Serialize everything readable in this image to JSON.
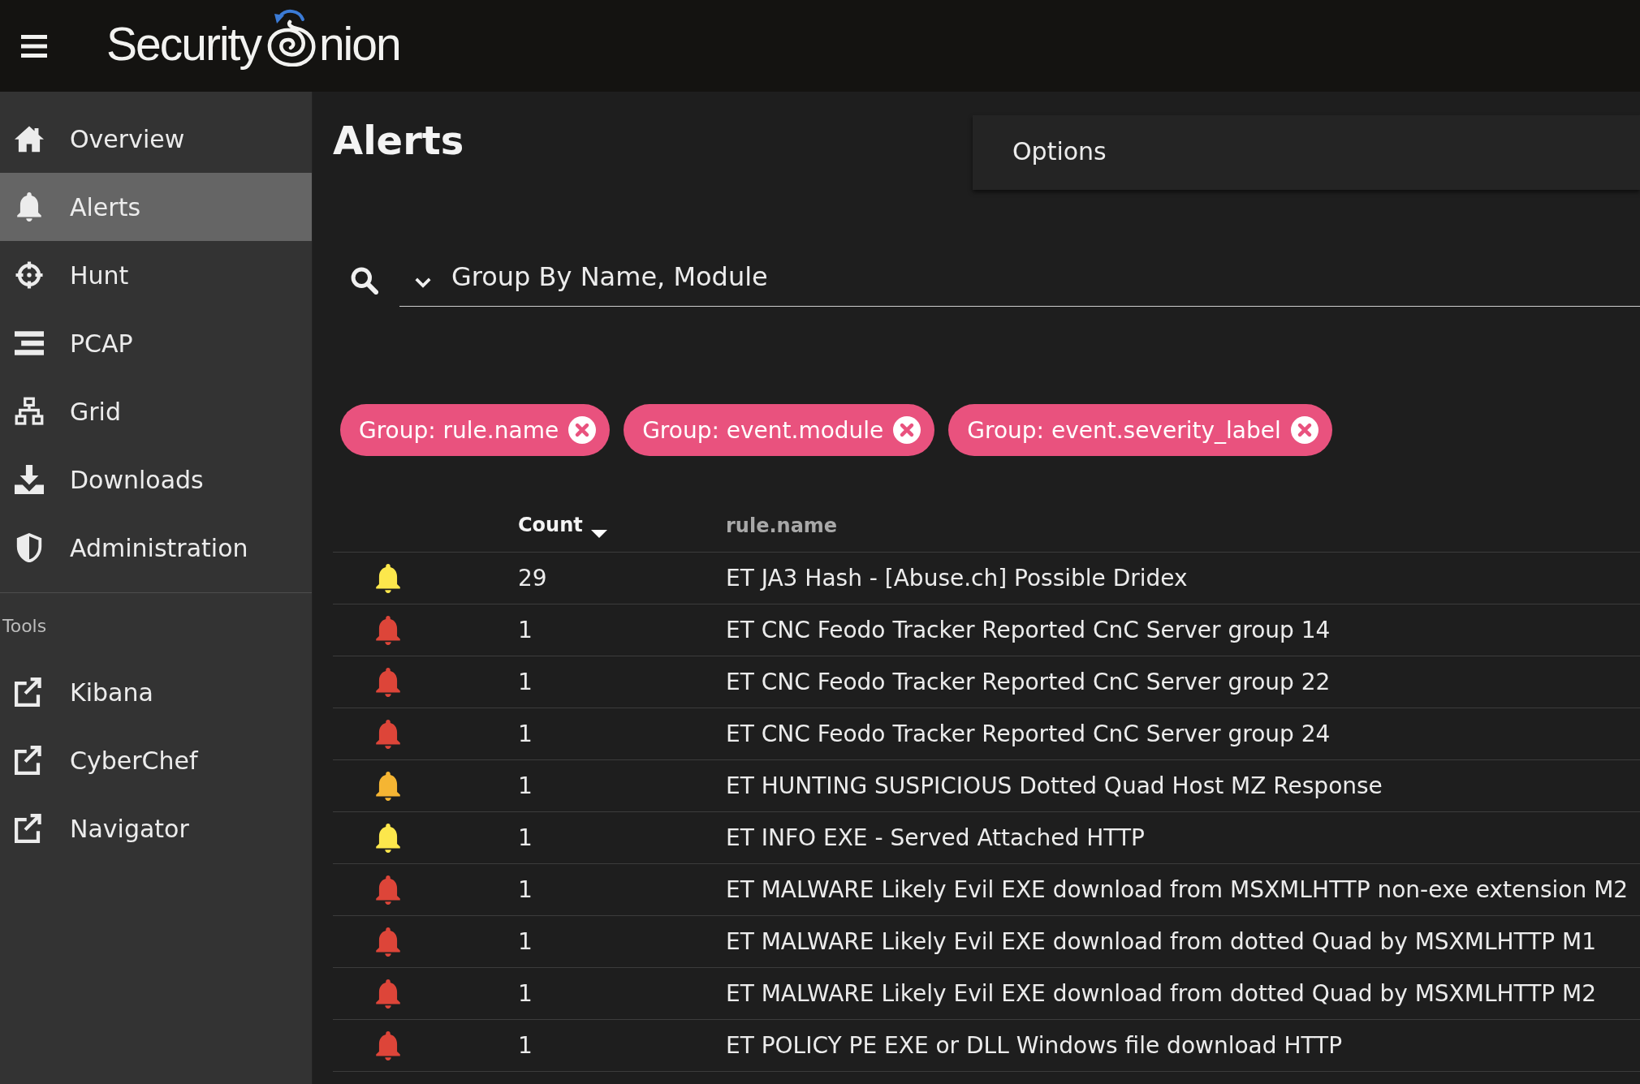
{
  "header": {
    "logo": {
      "before_mark": "Security",
      "after_mark": "nion"
    }
  },
  "sidebar": {
    "items": [
      {
        "label": "Overview",
        "selected": false
      },
      {
        "label": "Alerts",
        "selected": true
      },
      {
        "label": "Hunt",
        "selected": false
      },
      {
        "label": "PCAP",
        "selected": false
      },
      {
        "label": "Grid",
        "selected": false
      },
      {
        "label": "Downloads",
        "selected": false
      },
      {
        "label": "Administration",
        "selected": false
      }
    ],
    "tools_heading": "Tools",
    "tools": [
      {
        "label": "Kibana"
      },
      {
        "label": "CyberChef"
      },
      {
        "label": "Navigator"
      }
    ]
  },
  "page": {
    "title": "Alerts",
    "options_panel": {
      "label": "Options"
    }
  },
  "query": {
    "value": "Group By Name, Module"
  },
  "group_chips": [
    {
      "label": "Group: rule.name"
    },
    {
      "label": "Group: event.module"
    },
    {
      "label": "Group: event.severity_label"
    }
  ],
  "table": {
    "columns": [
      {
        "label": "Count",
        "sorted": true
      },
      {
        "label": "rule.name",
        "sorted": false
      }
    ],
    "rows": [
      {
        "color": "#fce74c",
        "count": "29",
        "rule_name": "ET JA3 Hash - [Abuse.ch] Possible Dridex"
      },
      {
        "color": "#dd4539",
        "count": "1",
        "rule_name": "ET CNC Feodo Tracker Reported CnC Server group 14"
      },
      {
        "color": "#dd4539",
        "count": "1",
        "rule_name": "ET CNC Feodo Tracker Reported CnC Server group 22"
      },
      {
        "color": "#dd4539",
        "count": "1",
        "rule_name": "ET CNC Feodo Tracker Reported CnC Server group 24"
      },
      {
        "color": "#f5b533",
        "count": "1",
        "rule_name": "ET HUNTING SUSPICIOUS Dotted Quad Host MZ Response"
      },
      {
        "color": "#fce74c",
        "count": "1",
        "rule_name": "ET INFO EXE - Served Attached HTTP"
      },
      {
        "color": "#dd4539",
        "count": "1",
        "rule_name": "ET MALWARE Likely Evil EXE download from MSXMLHTTP non-exe extension M2"
      },
      {
        "color": "#dd4539",
        "count": "1",
        "rule_name": "ET MALWARE Likely Evil EXE download from dotted Quad by MSXMLHTTP M1"
      },
      {
        "color": "#dd4539",
        "count": "1",
        "rule_name": "ET MALWARE Likely Evil EXE download from dotted Quad by MSXMLHTTP M2"
      },
      {
        "color": "#dd4539",
        "count": "1",
        "rule_name": "ET POLICY PE EXE or DLL Windows file download HTTP"
      }
    ]
  }
}
